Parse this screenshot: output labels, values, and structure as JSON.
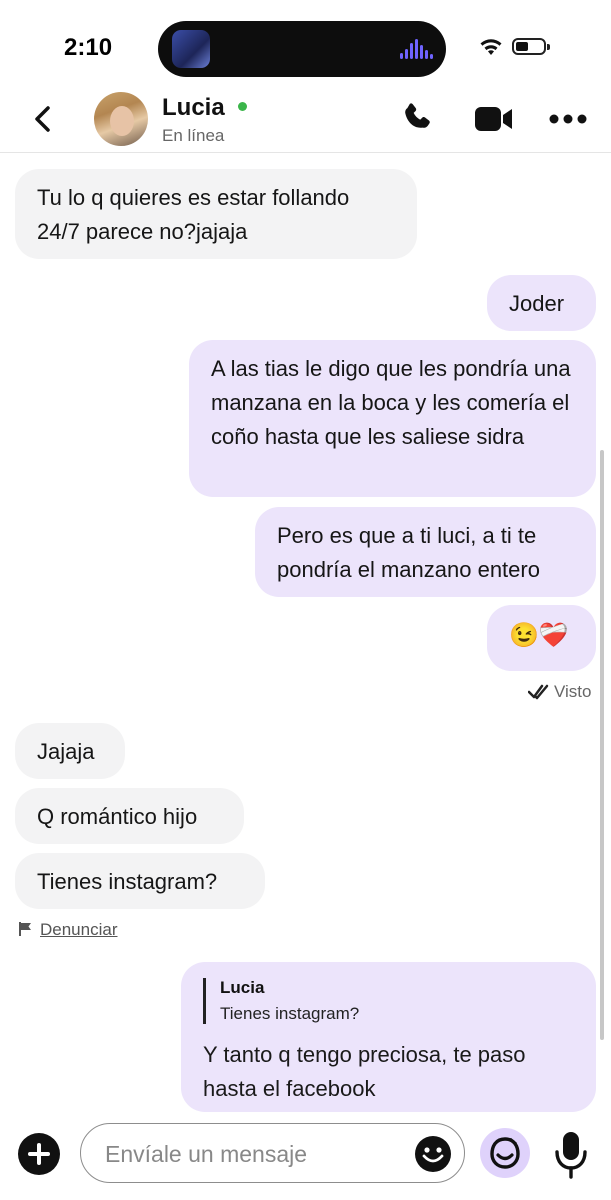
{
  "status_bar": {
    "time": "2:10"
  },
  "header": {
    "contact_name": "Lucia",
    "presence": "En línea"
  },
  "messages": [
    {
      "text": "Tu lo q quieres es estar follando 24/7 parece no?jajaja"
    },
    {
      "text": "Joder"
    },
    {
      "text": "A las tias le digo que les pondría una manzana en la boca y les comería el coño hasta que les saliese sidra"
    },
    {
      "text": "Pero es que a ti luci, a ti te pondría el manzano entero"
    },
    {
      "text": "😉❤️‍🩹"
    },
    {
      "text": "Jajaja"
    },
    {
      "text": "Q romántico hijo"
    },
    {
      "text": "Tienes instagram?"
    }
  ],
  "seen_label": "Visto",
  "report_label": "Denunciar",
  "reply": {
    "quoted_name": "Lucia",
    "quoted_text": "Tienes instagram?",
    "text": "Y tanto q tengo preciosa, te paso hasta el facebook"
  },
  "composer": {
    "placeholder": "Envíale un mensaje"
  },
  "colors": {
    "outgoing_bubble": "#ece4fb",
    "incoming_bubble": "#f3f3f4",
    "online": "#3bb54a"
  }
}
